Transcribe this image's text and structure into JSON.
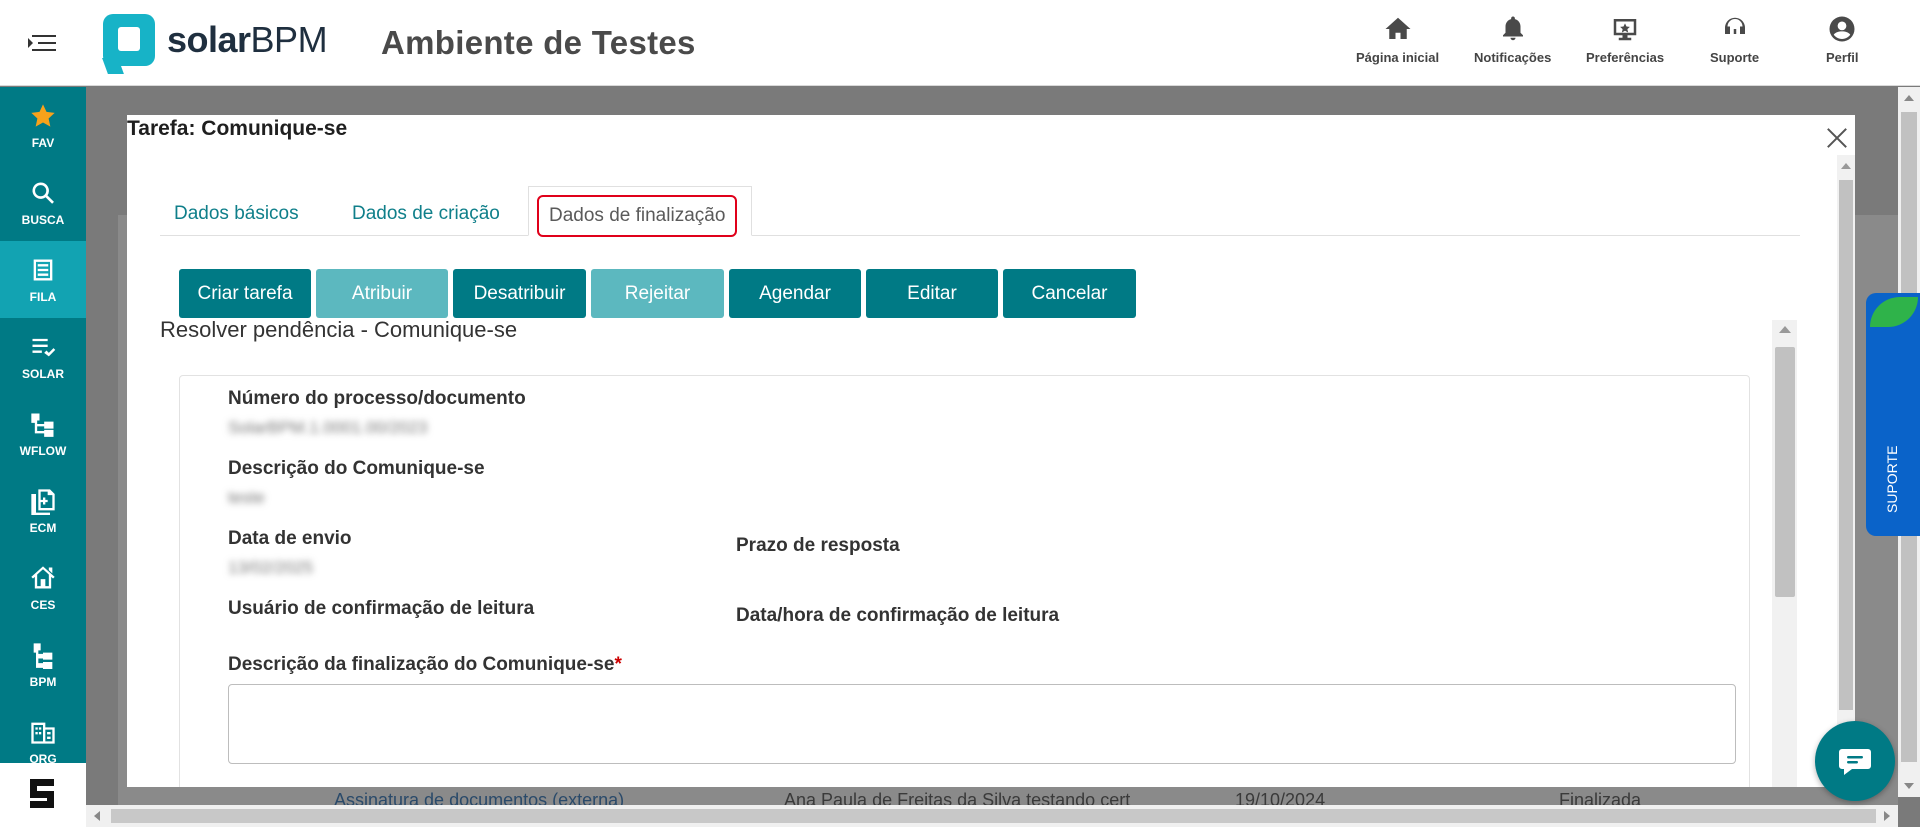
{
  "header": {
    "logo_text_bold": "solar",
    "logo_text_light": "BPM",
    "app_title": "Ambiente de Testes",
    "nav": [
      {
        "label": "Página inicial",
        "icon": "home-icon"
      },
      {
        "label": "Notificações",
        "icon": "bell-icon"
      },
      {
        "label": "Preferências",
        "icon": "preferences-icon"
      },
      {
        "label": "Suporte",
        "icon": "support-icon"
      },
      {
        "label": "Perfil",
        "icon": "user-icon"
      }
    ]
  },
  "sidebar": {
    "items": [
      {
        "label": "FAV",
        "icon": "star-icon"
      },
      {
        "label": "BUSCA",
        "icon": "search-icon"
      },
      {
        "label": "FILA",
        "icon": "queue-icon",
        "active": true
      },
      {
        "label": "SOLAR",
        "icon": "checklist-icon"
      },
      {
        "label": "WFLOW",
        "icon": "workflow-icon"
      },
      {
        "label": "ECM",
        "icon": "document-icon"
      },
      {
        "label": "CES",
        "icon": "house-icon"
      },
      {
        "label": "BPM",
        "icon": "process-icon"
      },
      {
        "label": "ORG",
        "icon": "building-icon"
      }
    ]
  },
  "modal": {
    "title": "Tarefa: Comunique-se",
    "tabs": [
      {
        "label": "Dados básicos"
      },
      {
        "label": "Dados de criação"
      },
      {
        "label": "Dados de finalização",
        "active": true
      }
    ],
    "buttons": [
      {
        "label": "Criar tarefa",
        "enabled": true
      },
      {
        "label": "Atribuir",
        "enabled": false
      },
      {
        "label": "Desatribuir",
        "enabled": true
      },
      {
        "label": "Rejeitar",
        "enabled": false
      },
      {
        "label": "Agendar",
        "enabled": true
      },
      {
        "label": "Editar",
        "enabled": true
      },
      {
        "label": "Cancelar",
        "enabled": true
      }
    ],
    "section_title": "Resolver pendência - Comunique-se",
    "fields": {
      "process_number": {
        "label": "Número do processo/documento",
        "value": "SolarBPM.1.0001.00/2023"
      },
      "description": {
        "label": "Descrição do Comunique-se",
        "value": "teste"
      },
      "send_date": {
        "label": "Data de envio",
        "value": "13/02/2025"
      },
      "response_deadline": {
        "label": "Prazo de resposta"
      },
      "read_confirmation_user": {
        "label": "Usuário de confirmação de leitura"
      },
      "read_confirmation_datetime": {
        "label": "Data/hora de confirmação de leitura"
      },
      "finalization_description": {
        "label": "Descrição da finalização do Comunique-se",
        "required_mark": "*"
      }
    }
  },
  "background_row": {
    "link": "Assinatura de documentos (externa)",
    "name": "Ana Paula de Freitas da Silva testando cert",
    "date": "19/10/2024",
    "status": "Finalizada"
  },
  "support_tab": {
    "label": "SUPORTE"
  },
  "colors": {
    "primary": "#007a85",
    "primary_disabled": "#5cb8bf",
    "sidebar_active": "#12a3b2",
    "highlight": "#e0001a",
    "support_blue": "#0a63c9"
  }
}
